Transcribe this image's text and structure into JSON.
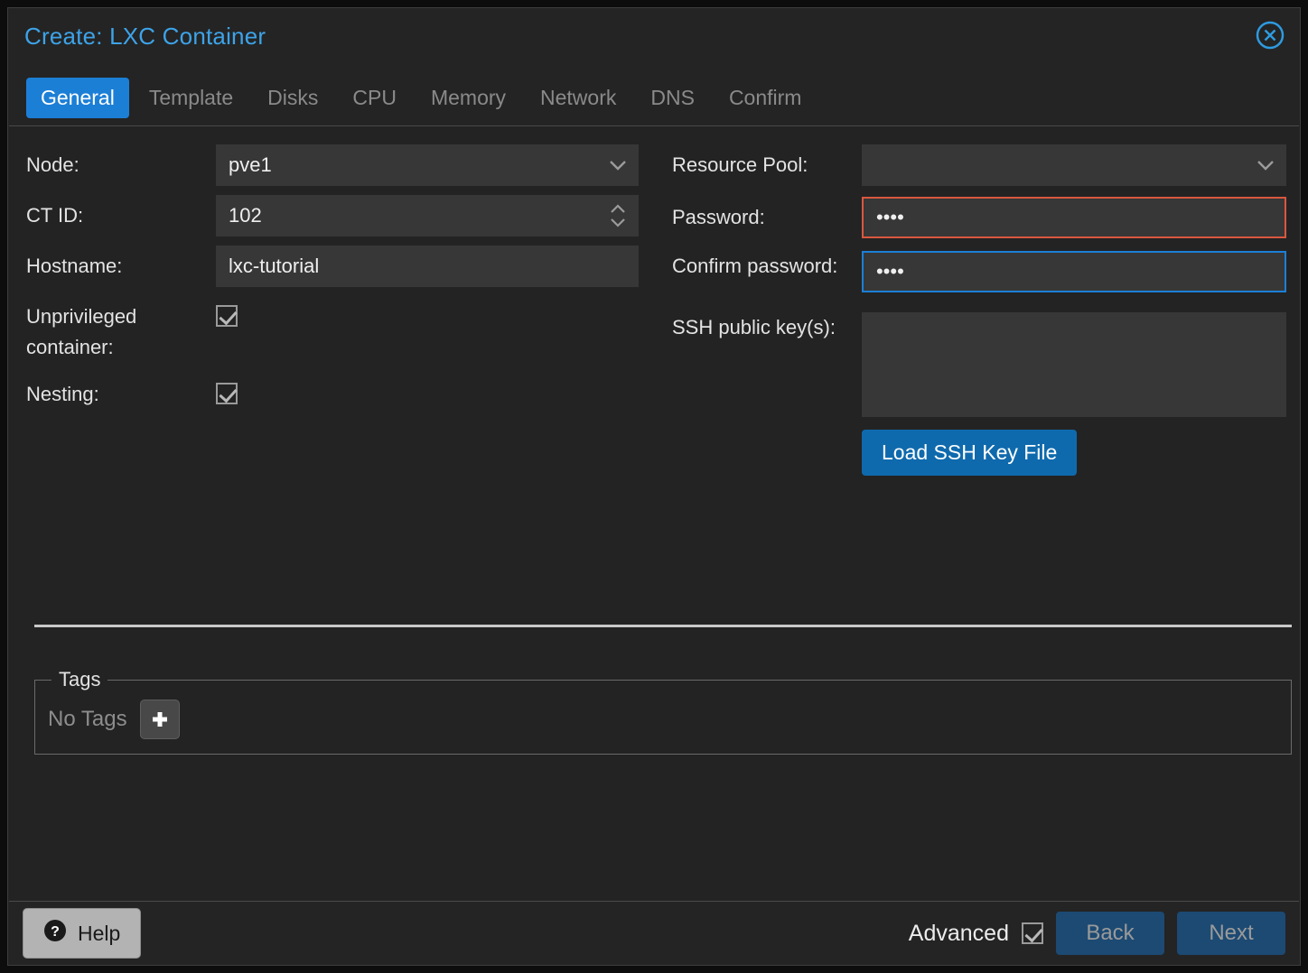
{
  "window": {
    "title": "Create: LXC Container",
    "close_icon": "close-circle-icon"
  },
  "tabs": [
    {
      "label": "General",
      "active": true
    },
    {
      "label": "Template",
      "active": false
    },
    {
      "label": "Disks",
      "active": false
    },
    {
      "label": "CPU",
      "active": false
    },
    {
      "label": "Memory",
      "active": false
    },
    {
      "label": "Network",
      "active": false
    },
    {
      "label": "DNS",
      "active": false
    },
    {
      "label": "Confirm",
      "active": false
    }
  ],
  "form": {
    "left": {
      "node": {
        "label": "Node:",
        "value": "pve1",
        "adorn": "chevron-down-icon"
      },
      "ct_id": {
        "label": "CT ID:",
        "value": "102",
        "adorn": "spinner-updown-icon"
      },
      "hostname": {
        "label": "Hostname:",
        "value": "lxc-tutorial"
      },
      "unprivileged": {
        "label": "Unprivileged container:",
        "checked": true
      },
      "nesting": {
        "label": "Nesting:",
        "checked": true
      }
    },
    "right": {
      "resource_pool": {
        "label": "Resource Pool:",
        "value": "",
        "adorn": "chevron-down-icon"
      },
      "password": {
        "label": "Password:",
        "value": "••••",
        "state": "invalid"
      },
      "confirm_password": {
        "label": "Confirm password:",
        "value": "••••",
        "state": "focused"
      },
      "ssh_keys": {
        "label": "SSH public key(s):",
        "value": ""
      },
      "load_ssh_button": "Load SSH Key File"
    }
  },
  "tags": {
    "legend": "Tags",
    "empty_text": "No Tags",
    "add_icon": "plus-icon"
  },
  "footer": {
    "help_label": "Help",
    "help_icon": "question-circle-icon",
    "advanced_label": "Advanced",
    "advanced_checked": true,
    "back_label": "Back",
    "next_label": "Next"
  },
  "colors": {
    "accent_blue": "#1c7fd6",
    "title_blue": "#3da3e8",
    "invalid_red": "#d9573f",
    "panel_bg": "#232323",
    "field_bg": "#373737",
    "button_blue": "#0f6aad",
    "nav_blue": "#1c4a73"
  }
}
